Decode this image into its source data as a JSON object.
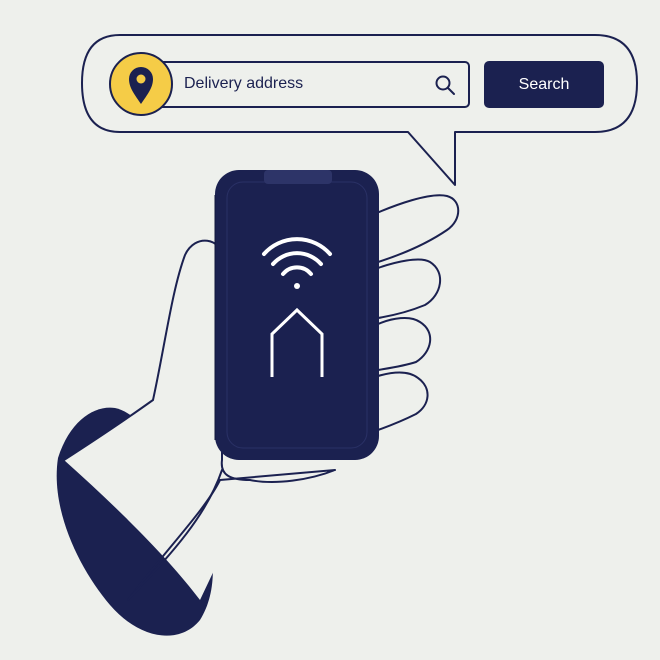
{
  "search_bar": {
    "placeholder": "Delivery address",
    "button_label": "Search"
  },
  "icons": {
    "location": "map-pin-icon",
    "search": "magnifier-icon",
    "wifi": "wifi-icon",
    "home": "house-outline-icon"
  },
  "colors": {
    "background": "#eef0ec",
    "navy": "#1b2150",
    "accent_yellow": "#f5cc47",
    "white": "#ffffff"
  }
}
